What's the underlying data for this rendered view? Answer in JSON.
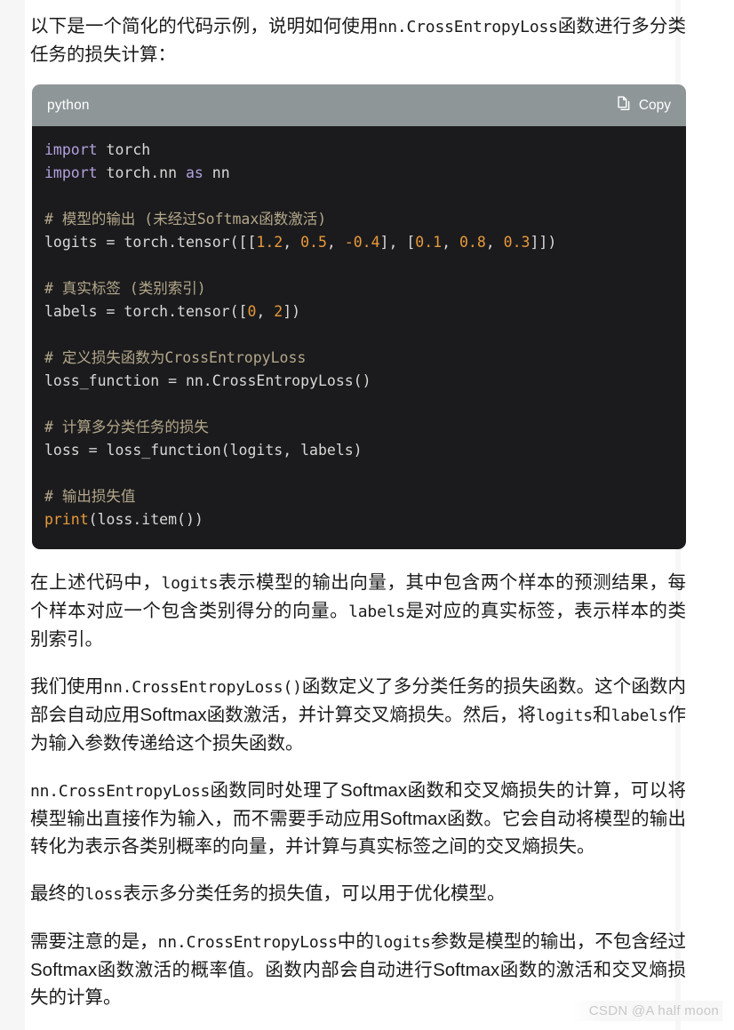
{
  "page": {
    "background": "#ffffff",
    "gutter_color": "#f6f6f7",
    "text_color": "#1a1a1a"
  },
  "intro": {
    "line_a": "以下是一个简化的代码示例，说明如何使用",
    "code_a": "nn.CrossEntropyLoss",
    "line_b": "函数进行多分类任务的损失计算："
  },
  "code_block": {
    "language_label": "python",
    "copy_label": "Copy",
    "copy_icon": "copy-icon",
    "header_bg": "#8e9697",
    "body_bg": "#1b1b1d",
    "colors": {
      "keyword": "#b3a0df",
      "comment": "#b3a78a",
      "number": "#e8993a",
      "builtin": "#e8993a",
      "plain": "#d8d8d8"
    },
    "lines": [
      [
        {
          "t": "import",
          "c": "kw"
        },
        {
          "t": " torch",
          "c": "pl"
        }
      ],
      [
        {
          "t": "import",
          "c": "kw"
        },
        {
          "t": " torch.nn ",
          "c": "pl"
        },
        {
          "t": "as",
          "c": "kw"
        },
        {
          "t": " nn",
          "c": "pl"
        }
      ],
      [],
      [
        {
          "t": "# 模型的输出 (未经过Softmax函数激活)",
          "c": "com"
        }
      ],
      [
        {
          "t": "logits = torch.tensor([[",
          "c": "pl"
        },
        {
          "t": "1.2",
          "c": "num"
        },
        {
          "t": ", ",
          "c": "pl"
        },
        {
          "t": "0.5",
          "c": "num"
        },
        {
          "t": ", ",
          "c": "pl"
        },
        {
          "t": "-0.4",
          "c": "num"
        },
        {
          "t": "], [",
          "c": "pl"
        },
        {
          "t": "0.1",
          "c": "num"
        },
        {
          "t": ", ",
          "c": "pl"
        },
        {
          "t": "0.8",
          "c": "num"
        },
        {
          "t": ", ",
          "c": "pl"
        },
        {
          "t": "0.3",
          "c": "num"
        },
        {
          "t": "]])",
          "c": "pl"
        }
      ],
      [],
      [
        {
          "t": "# 真实标签 (类别索引)",
          "c": "com"
        }
      ],
      [
        {
          "t": "labels = torch.tensor([",
          "c": "pl"
        },
        {
          "t": "0",
          "c": "num"
        },
        {
          "t": ", ",
          "c": "pl"
        },
        {
          "t": "2",
          "c": "num"
        },
        {
          "t": "])",
          "c": "pl"
        }
      ],
      [],
      [
        {
          "t": "# 定义损失函数为CrossEntropyLoss",
          "c": "com"
        }
      ],
      [
        {
          "t": "loss_function = nn.CrossEntropyLoss()",
          "c": "pl"
        }
      ],
      [],
      [
        {
          "t": "# 计算多分类任务的损失",
          "c": "com"
        }
      ],
      [
        {
          "t": "loss = loss_function(logits, labels)",
          "c": "pl"
        }
      ],
      [],
      [
        {
          "t": "# 输出损失值",
          "c": "com"
        }
      ],
      [
        {
          "t": "print",
          "c": "fn"
        },
        {
          "t": "(loss.item())",
          "c": "pl"
        }
      ]
    ]
  },
  "paragraphs": [
    {
      "id": "para-logits-labels",
      "runs": [
        {
          "t": "在上述代码中，",
          "code": false
        },
        {
          "t": "logits",
          "code": true
        },
        {
          "t": "表示模型的输出向量，其中包含两个样本的预测结果，每个样本对应一个包含类别得分的向量。",
          "code": false
        },
        {
          "t": "labels",
          "code": true
        },
        {
          "t": "是对应的真实标签，表示样本的类别索引。",
          "code": false
        }
      ]
    },
    {
      "id": "para-define-loss",
      "runs": [
        {
          "t": "我们使用",
          "code": false
        },
        {
          "t": "nn.CrossEntropyLoss()",
          "code": true
        },
        {
          "t": "函数定义了多分类任务的损失函数。这个函数内部会自动应用Softmax函数激活，并计算交叉熵损失。然后，将",
          "code": false
        },
        {
          "t": "logits",
          "code": true
        },
        {
          "t": "和",
          "code": false
        },
        {
          "t": "labels",
          "code": true
        },
        {
          "t": "作为输入参数传递给这个损失函数。",
          "code": false
        }
      ]
    },
    {
      "id": "para-handles-softmax",
      "runs": [
        {
          "t": "nn.CrossEntropyLoss",
          "code": true
        },
        {
          "t": "函数同时处理了Softmax函数和交叉熵损失的计算，可以将模型输出直接作为输入，而不需要手动应用Softmax函数。它会自动将模型的输出转化为表示各类别概率的向量，并计算与真实标签之间的交叉熵损失。",
          "code": false
        }
      ]
    },
    {
      "id": "para-final-loss",
      "runs": [
        {
          "t": "最终的",
          "code": false
        },
        {
          "t": "loss",
          "code": true
        },
        {
          "t": "表示多分类任务的损失值，可以用于优化模型。",
          "code": false
        }
      ]
    },
    {
      "id": "para-note",
      "runs": [
        {
          "t": "需要注意的是，",
          "code": false
        },
        {
          "t": "nn.CrossEntropyLoss",
          "code": true
        },
        {
          "t": "中的",
          "code": false
        },
        {
          "t": "logits",
          "code": true
        },
        {
          "t": "参数是模型的输出，不包含经过Softmax函数激活的概率值。函数内部会自动进行Softmax函数的激活和交叉熵损失的计算。",
          "code": false
        }
      ]
    }
  ],
  "watermark": {
    "text": "CSDN @A half moon"
  }
}
